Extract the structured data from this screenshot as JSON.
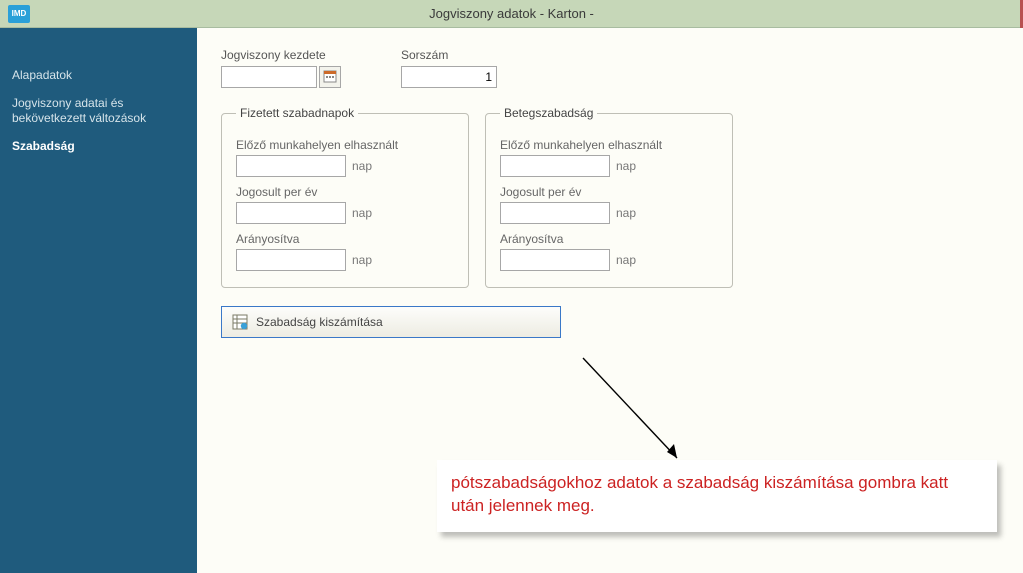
{
  "titlebar": {
    "title": "Jogviszony adatok - Karton  -",
    "app_icon_text": "IMD"
  },
  "sidebar": {
    "items": [
      {
        "label": "Alapadatok"
      },
      {
        "label": "Jogviszony adatai és bekövetkezett változások"
      },
      {
        "label": "Szabadság"
      }
    ],
    "active_index": 2
  },
  "top": {
    "start_label": "Jogviszony kezdete",
    "start_value": "",
    "seq_label": "Sorszám",
    "seq_value": "1"
  },
  "groups": {
    "paid": {
      "legend": "Fizetett szabadnapok",
      "fields": [
        {
          "label": "Előző munkahelyen elhasznált",
          "value": "",
          "unit": "nap"
        },
        {
          "label": "Jogosult per év",
          "value": "",
          "unit": "nap"
        },
        {
          "label": "Arányosítva",
          "value": "",
          "unit": "nap"
        }
      ]
    },
    "sick": {
      "legend": "Betegszabadság",
      "fields": [
        {
          "label": "Előző munkahelyen elhasznált",
          "value": "",
          "unit": "nap"
        },
        {
          "label": "Jogosult per év",
          "value": "",
          "unit": "nap"
        },
        {
          "label": "Arányosítva",
          "value": "",
          "unit": "nap"
        }
      ]
    }
  },
  "button": {
    "label": "Szabadság kiszámítása"
  },
  "annotation": {
    "text": "pótszabadságokhoz adatok a szabadság kiszámítása gombra katt után jelennek meg."
  }
}
